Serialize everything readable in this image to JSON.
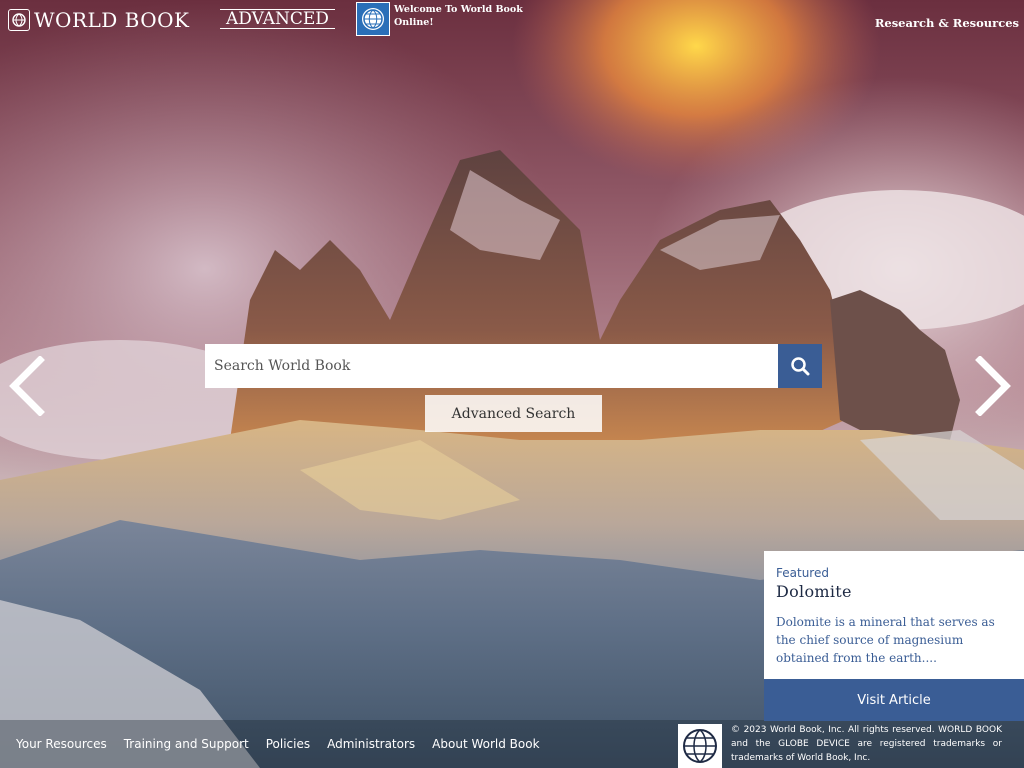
{
  "header": {
    "logo_text": "WORLD BOOK",
    "logo_badge": "ADVANCED",
    "welcome_text": "Welcome To World Book Online!",
    "research_link": "Research & Resources"
  },
  "search": {
    "placeholder": "Search World Book",
    "search_icon": "magnifier-icon",
    "advanced_label": "Advanced Search"
  },
  "carousel": {
    "prev_icon": "chevron-left-icon",
    "next_icon": "chevron-right-icon"
  },
  "featured": {
    "label": "Featured",
    "title": "Dolomite",
    "description": "Dolomite is a mineral that serves as the chief source of magnesium obtained from the earth....",
    "button": "Visit Article"
  },
  "footer": {
    "links": [
      "Your Resources",
      "Training and Support",
      "Policies",
      "Administrators",
      "About World Book"
    ],
    "copyright": "© 2023 World Book, Inc. All rights reserved. WORLD BOOK and the GLOBE DEVICE are registered trademarks or trademarks of World Book, Inc."
  },
  "colors": {
    "accent": "#3a5d95",
    "icon_blue": "#2a6fb8"
  }
}
